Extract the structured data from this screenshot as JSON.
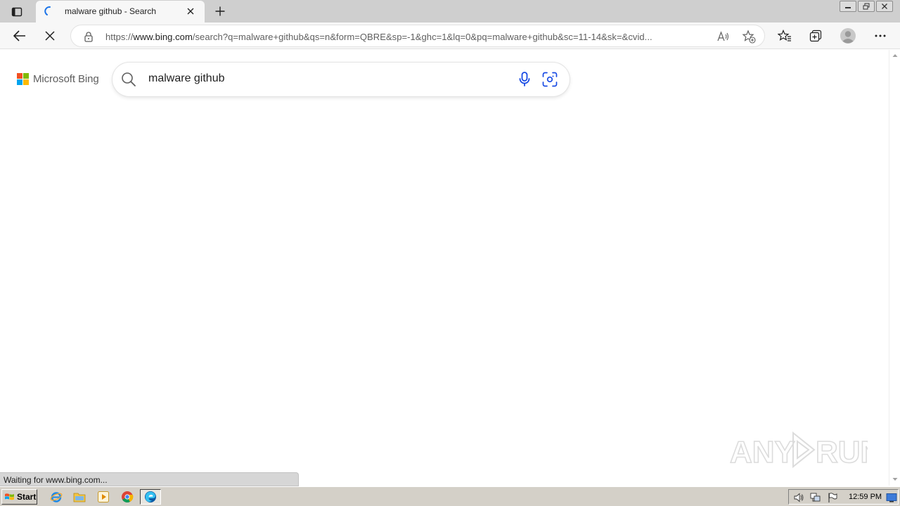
{
  "browser": {
    "tab": {
      "title": "malware github - Search",
      "loading": true
    },
    "address": {
      "scheme": "https://",
      "host": "www.bing.com",
      "path": "/search?q=malware+github&qs=n&form=QBRE&sp=-1&ghc=1&lq=0&pq=malware+github&sc=11-14&sk=&cvid..."
    }
  },
  "page": {
    "logo": {
      "text": "Microsoft Bing"
    },
    "search": {
      "query": "malware github"
    },
    "watermark": "ANY RUN"
  },
  "status": {
    "text": "Waiting for www.bing.com..."
  },
  "taskbar": {
    "start_label": "Start",
    "clock": "12:59 PM"
  },
  "colors": {
    "ms_red": "#f25022",
    "ms_green": "#7fba00",
    "ms_blue": "#00a4ef",
    "ms_yellow": "#ffb900",
    "mic_blue": "#174ae4"
  }
}
